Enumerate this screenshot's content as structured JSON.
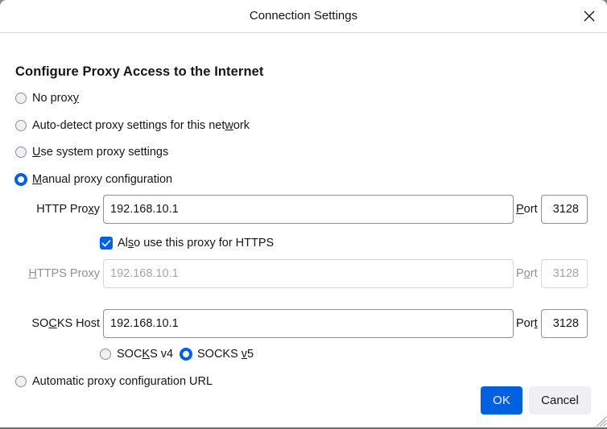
{
  "dialog": {
    "title": "Connection Settings",
    "close_icon": "close-icon"
  },
  "section": {
    "heading": "Configure Proxy Access to the Internet"
  },
  "proxy_modes": [
    {
      "label_pre": "No prox",
      "label_u": "y",
      "label_post": "",
      "selected": false
    },
    {
      "label_pre": "Auto-detect proxy settings for this net",
      "label_u": "w",
      "label_post": "ork",
      "selected": false
    },
    {
      "label_pre": "",
      "label_u": "U",
      "label_post": "se system proxy settings",
      "selected": false
    },
    {
      "label_pre": "",
      "label_u": "M",
      "label_post": "anual proxy configuration",
      "selected": true
    },
    {
      "label_pre": "Automatic proxy configuration URL",
      "label_u": "",
      "label_post": "",
      "selected": false
    }
  ],
  "manual": {
    "http": {
      "label_pre": "HTTP Pro",
      "label_u": "x",
      "label_post": "y",
      "value": "192.168.10.1",
      "port_label_pre": "",
      "port_label_u": "P",
      "port_label_post": "ort",
      "port": "3128"
    },
    "also_https": {
      "label_pre": "Al",
      "label_u": "s",
      "label_post": "o use this proxy for HTTPS",
      "checked": true
    },
    "https": {
      "label_pre": "",
      "label_u": "H",
      "label_post": "TTPS Proxy",
      "value": "192.168.10.1",
      "port_label_pre": "P",
      "port_label_u": "o",
      "port_label_post": "rt",
      "port": "3128",
      "disabled": true
    },
    "socks": {
      "label_pre": "SO",
      "label_u": "C",
      "label_post": "KS Host",
      "value": "192.168.10.1",
      "port_label_pre": "Por",
      "port_label_u": "t",
      "port_label_post": "",
      "port": "3128"
    },
    "socks_versions": [
      {
        "label_pre": "SOC",
        "label_u": "K",
        "label_post": "S v4",
        "selected": false
      },
      {
        "label_pre": "SOCKS ",
        "label_u": "v",
        "label_post": "5",
        "selected": true
      }
    ]
  },
  "buttons": {
    "ok": "OK",
    "cancel": "Cancel"
  },
  "colors": {
    "accent": "#0061e0",
    "text": "#15141a",
    "disabled_text": "#8f8f9d",
    "secondary_button": "#f0f0f4"
  }
}
